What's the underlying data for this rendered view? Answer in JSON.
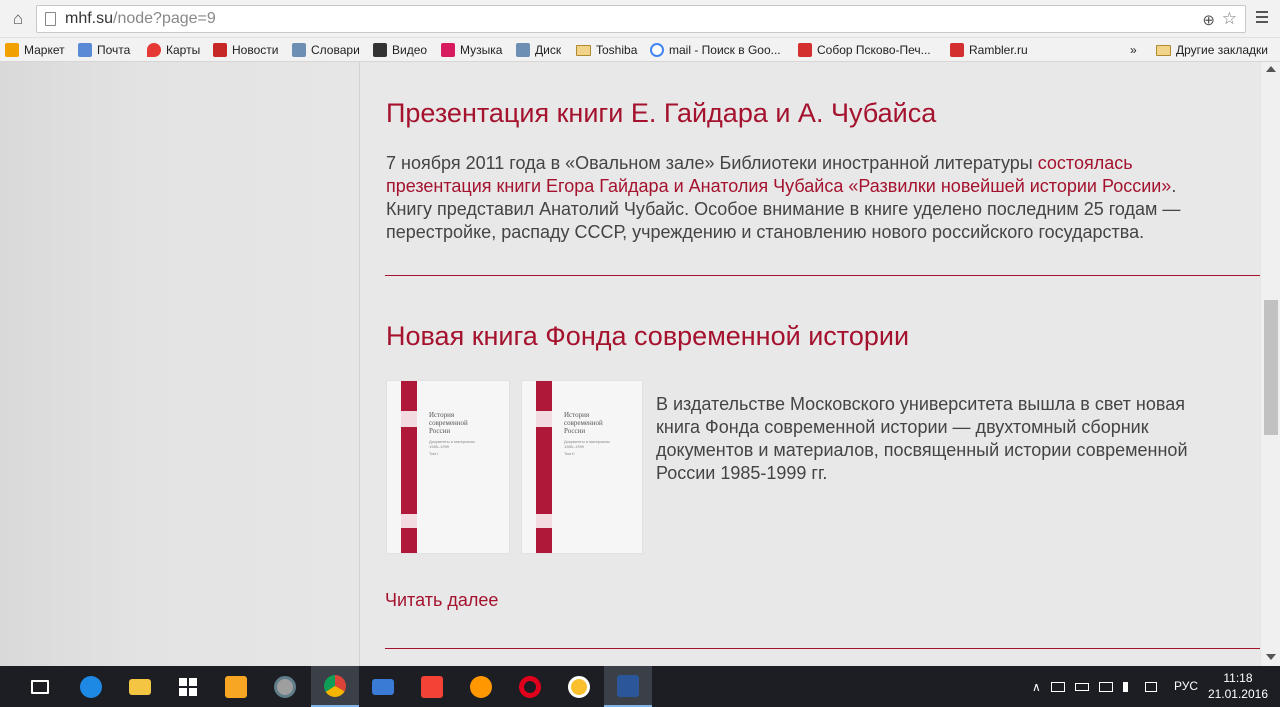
{
  "browser": {
    "url_main": "mhf.su",
    "url_rest": "/node?page=9",
    "icons": {
      "home": "home-icon",
      "zoom": "zoom-icon",
      "star": "star-icon",
      "menu": "menu-icon"
    }
  },
  "bookmarks": {
    "items": [
      {
        "label": "Маркет",
        "color": "#f0a000"
      },
      {
        "label": "Почта",
        "color": "#5a8ad6"
      },
      {
        "label": "Карты",
        "color": "#e53935"
      },
      {
        "label": "Новости",
        "color": "#c62828"
      },
      {
        "label": "Словари",
        "color": "#6d8fb3"
      },
      {
        "label": "Видео",
        "color": "#333333"
      },
      {
        "label": "Музыка",
        "color": "#d81b60"
      },
      {
        "label": "Диск",
        "color": "#6d8fb3"
      },
      {
        "label": "Toshiba",
        "color": "#e7c262"
      },
      {
        "label": "mail - Поиск в Goo...",
        "color": "#4285f4"
      },
      {
        "label": "Собор Псково-Печ...",
        "color": "#d32f2f"
      },
      {
        "label": "Rambler.ru",
        "color": "#d32f2f"
      }
    ],
    "overflow": "»",
    "other_label": "Другие закладки"
  },
  "articles": [
    {
      "title": "Презентация книги Е. Гайдара и А. Чубайса",
      "text_1": "7 ноября 2011 года в «Овальном зале» Библиотеки иностранной литературы ",
      "link_1": "состоялась",
      "link_2": "презентация книги Егора Гайдара и Анатолия Чубайса «Развилки новейшей истории России»",
      "text_2": ".",
      "text_3": "Книгу представил Анатолий Чубайс. Особое внимание в книге уделено последним 25 годам —",
      "text_4": "перестройке, распаду СССР, учреждению и становлению нового российского государства."
    },
    {
      "title": "Новая книга Фонда современной истории",
      "line_1": "В издательстве Московского университета вышла в свет новая",
      "line_2": "книга Фонда современной истории — двухтомный сборник",
      "line_3": "документов и материалов, посвященный истории современной",
      "line_4": "России 1985-1999 гг.",
      "book_title_1": "История",
      "book_title_2": "современной",
      "book_title_3": "России",
      "book_sub_1": "Документы и материалы",
      "book_sub_2": "1985–1999",
      "book_vol_1": "Том I",
      "book_vol_2": "Том II",
      "read_more": "Читать далее"
    }
  ],
  "taskbar": {
    "apps": [
      {
        "name": "task-view",
        "color": "#ffffff"
      },
      {
        "name": "edge",
        "color": "#1e88e5"
      },
      {
        "name": "explorer",
        "color": "#f4c542"
      },
      {
        "name": "store",
        "color": "#ffffff"
      },
      {
        "name": "media",
        "color": "#f6a623"
      },
      {
        "name": "app-grey",
        "color": "#9e9e9e"
      },
      {
        "name": "chrome",
        "color": "#4caf50"
      },
      {
        "name": "mail",
        "color": "#3a7bd5"
      },
      {
        "name": "yandex-y",
        "color": "#f44336"
      },
      {
        "name": "app-orange",
        "color": "#ff9800"
      },
      {
        "name": "opera",
        "color": "#e0001b"
      },
      {
        "name": "yandex-browser",
        "color": "#fbc02d"
      },
      {
        "name": "word",
        "color": "#2b579a"
      }
    ],
    "lang": "РУС",
    "time": "11:18",
    "date": "21.01.2016"
  }
}
